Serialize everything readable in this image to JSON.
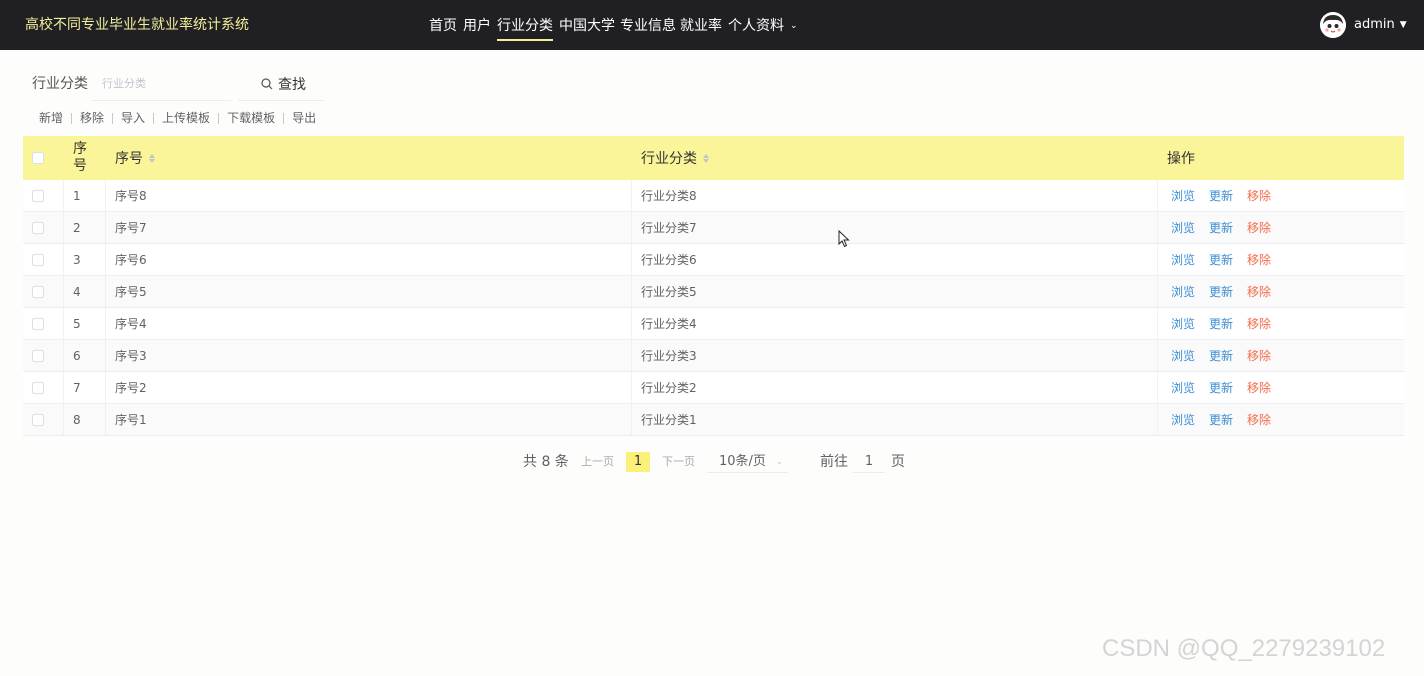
{
  "app": {
    "title": "高校不同专业毕业生就业率统计系统"
  },
  "nav": {
    "items": [
      {
        "label": "首页",
        "active": false
      },
      {
        "label": "用户",
        "active": false
      },
      {
        "label": "行业分类",
        "active": true
      },
      {
        "label": "中国大学",
        "active": false
      },
      {
        "label": "专业信息",
        "active": false
      },
      {
        "label": "就业率",
        "active": false
      },
      {
        "label": "个人资料",
        "active": false,
        "has_dropdown": true
      }
    ],
    "user": {
      "name": "admin",
      "avatar_icon": "avatar-cartoon-icon"
    }
  },
  "search": {
    "label": "行业分类",
    "placeholder": "行业分类",
    "value": "",
    "button_label": "查找",
    "button_icon": "search-icon"
  },
  "actions": {
    "add": "新增",
    "remove": "移除",
    "import": "导入",
    "upload_template": "上传模板",
    "download_template": "下载模板",
    "export": "导出"
  },
  "table": {
    "columns": {
      "index": "序号",
      "number": "序号",
      "category": "行业分类",
      "operations": "操作"
    },
    "rows": [
      {
        "index": "1",
        "number": "序号8",
        "category": "行业分类8"
      },
      {
        "index": "2",
        "number": "序号7",
        "category": "行业分类7"
      },
      {
        "index": "3",
        "number": "序号6",
        "category": "行业分类6"
      },
      {
        "index": "4",
        "number": "序号5",
        "category": "行业分类5"
      },
      {
        "index": "5",
        "number": "序号4",
        "category": "行业分类4"
      },
      {
        "index": "6",
        "number": "序号3",
        "category": "行业分类3"
      },
      {
        "index": "7",
        "number": "序号2",
        "category": "行业分类2"
      },
      {
        "index": "8",
        "number": "序号1",
        "category": "行业分类1"
      }
    ],
    "row_actions": {
      "view": "浏览",
      "edit": "更新",
      "delete": "移除"
    }
  },
  "pagination": {
    "total": "共 8 条",
    "prev": "上一页",
    "current_page": "1",
    "next": "下一页",
    "page_size": "10条/页",
    "goto_label": "前往",
    "goto_value": "1",
    "page_unit": "页"
  },
  "watermark": "CSDN @QQ_2279239102",
  "colors": {
    "navbar_bg": "#1f1f24",
    "accent_yellow": "#fbf59a",
    "title_yellow": "#f3ef9a",
    "link_blue": "#3a8fd6",
    "delete_orange": "#f56c4c"
  }
}
